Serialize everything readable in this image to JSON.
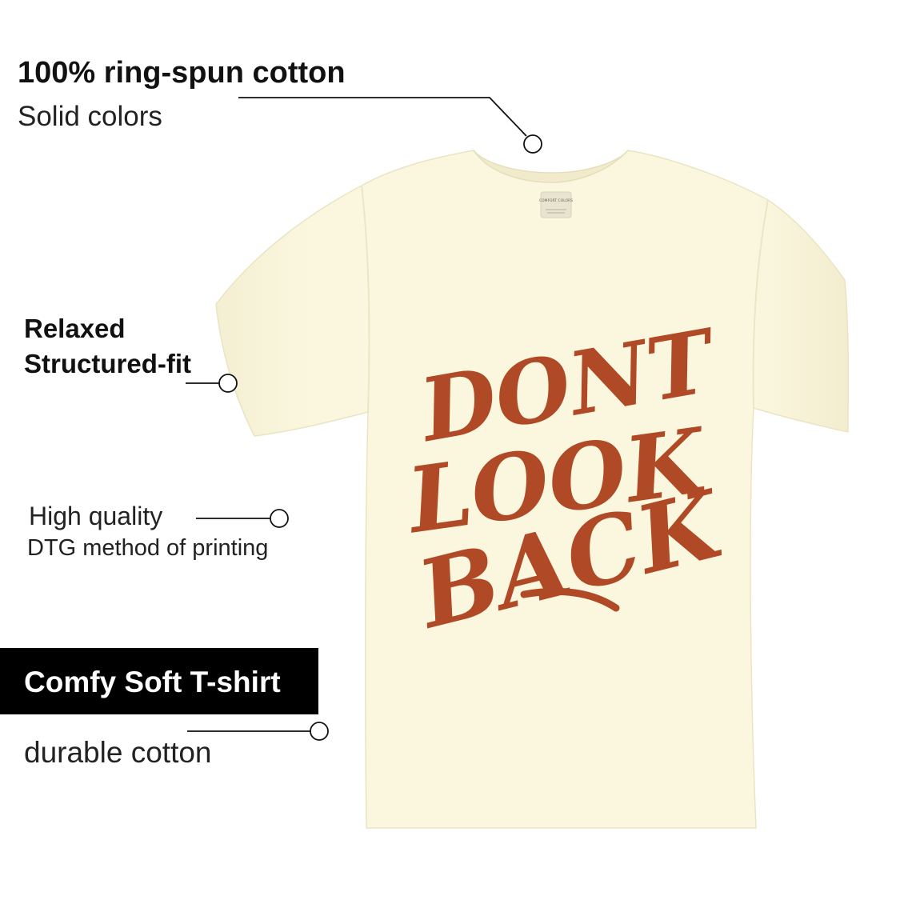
{
  "features": {
    "cotton_title": "100% ring-spun cotton",
    "cotton_sub": "Solid colors",
    "fit_line1": "Relaxed",
    "fit_line2": "Structured-fit",
    "print_line1": "High quality",
    "print_line2": "DTG method of printing",
    "badge_label": "Comfy Soft T-shirt",
    "durable": "durable cotton"
  },
  "shirt": {
    "graphic_lines": [
      "DONT",
      "LOOK",
      "BACK"
    ],
    "tag_text": "COMFORT COLORS",
    "shirt_color": "#fbf7df",
    "print_color": "#b04a26",
    "icon": "t-shirt"
  },
  "colors": {
    "badge_bg": "#000000",
    "badge_text": "#ffffff",
    "callout_line": "#111111"
  }
}
